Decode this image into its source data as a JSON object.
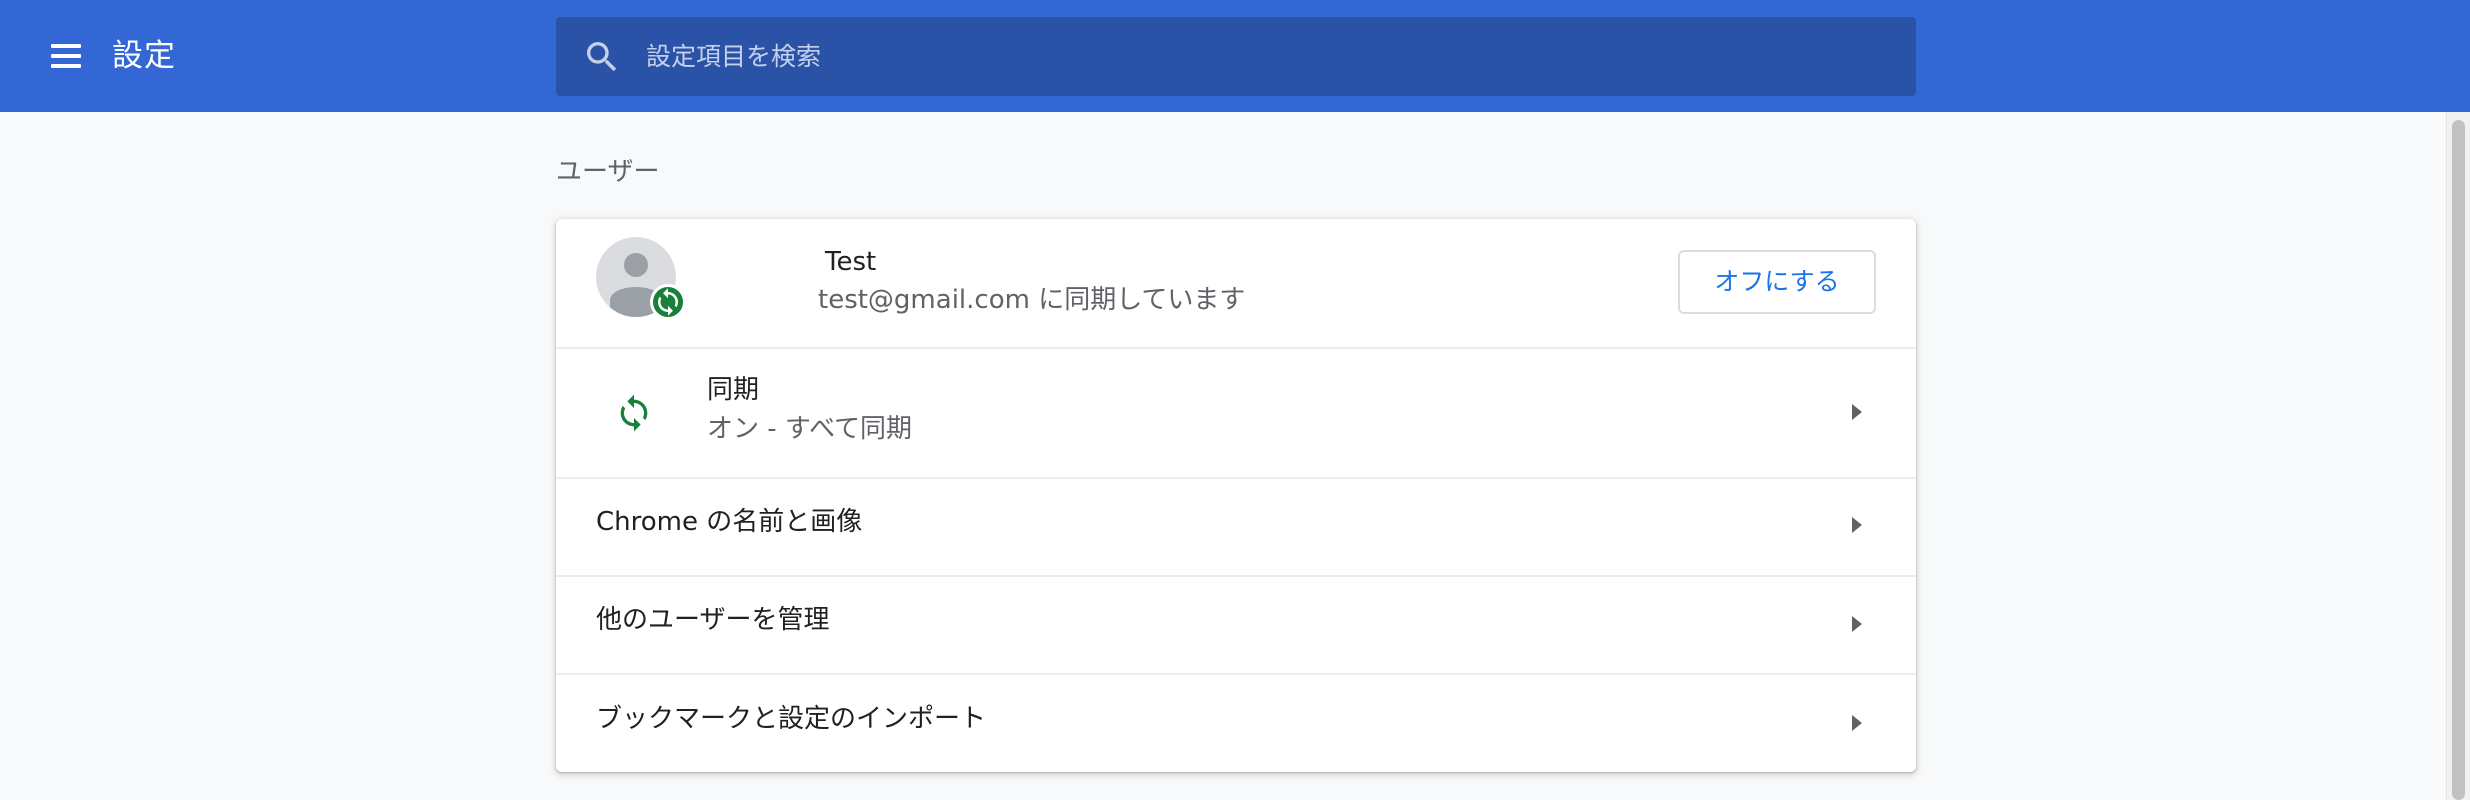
{
  "header": {
    "title": "設定",
    "search_placeholder": "設定項目を検索",
    "menu_icon": "hamburger-menu-icon",
    "search_icon": "search-icon",
    "color": "#3367d6"
  },
  "section": {
    "title": "ユーザー"
  },
  "account": {
    "name": "Test",
    "status": "test@gmail.com に同期しています",
    "turn_off_label": "オフにする",
    "avatar_icon": "person-avatar-icon",
    "badge_icon": "sync-badge-icon"
  },
  "rows": [
    {
      "title": "同期",
      "subtitle": "オン - すべて同期",
      "icon": "sync-icon"
    },
    {
      "title": "Chrome の名前と画像"
    },
    {
      "title": "他のユーザーを管理"
    },
    {
      "title": "ブックマークと設定のインポート"
    }
  ],
  "colors": {
    "sync_green": "#188038",
    "link_blue": "#1a73e8"
  }
}
